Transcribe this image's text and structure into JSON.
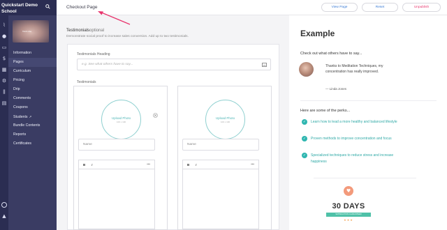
{
  "sidebar": {
    "school_name": "Quickstart Demo School",
    "thumbnail_label": "Welcome",
    "items": [
      {
        "label": "Information"
      },
      {
        "label": "Pages"
      },
      {
        "label": "Curriculum"
      },
      {
        "label": "Pricing"
      },
      {
        "label": "Drip"
      },
      {
        "label": "Comments"
      },
      {
        "label": "Coupons"
      },
      {
        "label": "Students"
      },
      {
        "label": "Bundle Contents"
      },
      {
        "label": "Reports"
      },
      {
        "label": "Certificates"
      }
    ],
    "bg_color": "#3a3c63",
    "rail_color": "#2b2d52"
  },
  "header": {
    "title": "Checkout Page",
    "view_page_label": "View Page",
    "reset_label": "Reset",
    "unpublish_label": "Unpublish",
    "accent": "#e8356d"
  },
  "form": {
    "section_title": "Testimonials",
    "section_optional": "optional",
    "section_desc": "Demonstrate social proof to increase sales conversion. Add up to two testimonials.",
    "heading_label": "Testimonials Heading",
    "heading_placeholder": "e.g. See what others have to say...",
    "testimonials_label": "Testimonials",
    "cards": [
      {
        "upload_label": "Upload Photo",
        "upload_size": "100 x 100",
        "name_placeholder": "Name",
        "bold": "B",
        "italic": "I",
        "more": "•••"
      },
      {
        "upload_label": "Upload Photo",
        "upload_size": "100 x 100",
        "name_placeholder": "Name",
        "bold": "B",
        "italic": "I",
        "more": "•••"
      }
    ]
  },
  "preview": {
    "title": "Example",
    "quote_heading": "Check out what others have to say...",
    "quote_text": "Thanks to Meditation Techniques, my concentration has really improved.",
    "quote_author": "— Linda Jones",
    "perks_heading": "Here are some of the perks...",
    "perks": [
      "Learn how to lead a more healthy and balanced lifestyle",
      "Proven methods to improve concentration and focus",
      "Specialized techniques to reduce stress and increase happiness"
    ],
    "badge_days": "30 DAYS",
    "badge_ribbon": "SATISFACTION GUARANTEED",
    "badge_stars": "★★★",
    "accent": "#2fb6b0"
  }
}
